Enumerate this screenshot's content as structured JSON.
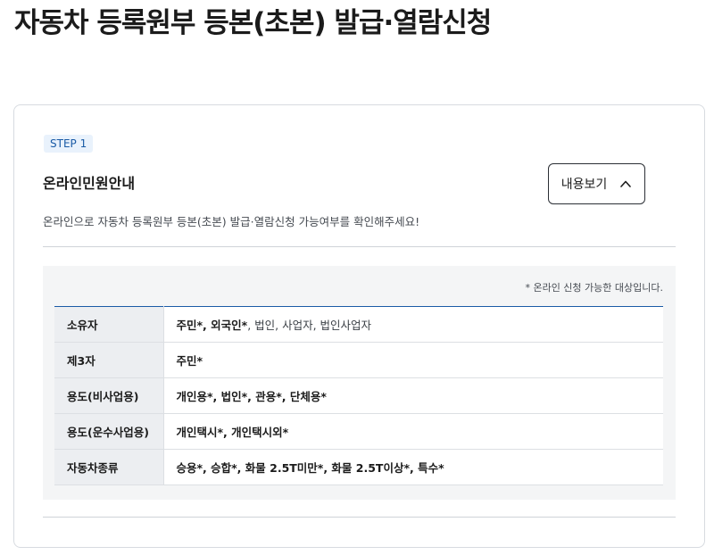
{
  "page_title": "자동차 등록원부 등본(초본) 발급·열람신청",
  "step": {
    "badge": "STEP 1",
    "title": "온라인민원안내",
    "toggle_label": "내용보기",
    "toggle_icon": "chevron-up-icon",
    "description": "온라인으로 자동차 등록원부 등본(초본) 발급·열람신청 가능여부를 확인해주세요!"
  },
  "info": {
    "note": "* 온라인 신청 가능한 대상입니다.",
    "rows": [
      {
        "label": "소유자",
        "items": [
          {
            "text": "주민*",
            "bold": true
          },
          {
            "text": ", ",
            "bold": true
          },
          {
            "text": "외국인*",
            "bold": true
          },
          {
            "text": ", 법인, 사업자, 법인사업자",
            "bold": false
          }
        ]
      },
      {
        "label": "제3자",
        "items": [
          {
            "text": "주민*",
            "bold": true
          }
        ]
      },
      {
        "label": "용도(비사업용)",
        "items": [
          {
            "text": "개인용*, 법인*, 관용*, 단체용*",
            "bold": true
          }
        ]
      },
      {
        "label": "용도(운수사업용)",
        "items": [
          {
            "text": "개인택시*, 개인택시외*",
            "bold": true
          }
        ]
      },
      {
        "label": "자동차종류",
        "items": [
          {
            "text": "승용*, 승합*, 화물 2.5T미만*, 화물 2.5T이상*, 특수*",
            "bold": true
          }
        ]
      }
    ]
  },
  "colors": {
    "accent": "#1a5ba6",
    "badge_bg": "#e9f2fc",
    "box_bg": "#f4f5f6",
    "header_cell_bg": "#eceef1"
  }
}
